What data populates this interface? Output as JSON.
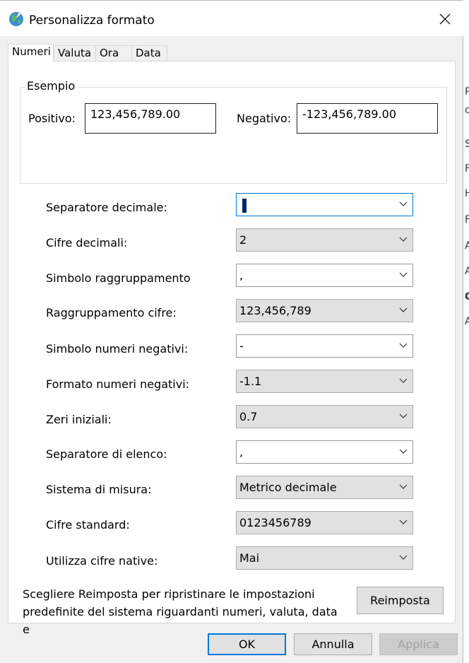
{
  "window": {
    "title": "Personalizza formato",
    "app_icon": "globe-icon",
    "close_icon": "close-icon"
  },
  "tabs": [
    {
      "label": "Numeri",
      "active": true
    },
    {
      "label": "Valuta",
      "active": false
    },
    {
      "label": "Ora",
      "active": false
    },
    {
      "label": "Data",
      "active": false
    }
  ],
  "example": {
    "legend": "Esempio",
    "positive_label": "Positivo:",
    "positive_value": "123,456,789.00",
    "negative_label": "Negativo:",
    "negative_value": "-123,456,789.00"
  },
  "settings": [
    {
      "label": "Separatore decimale:",
      "value": "",
      "kind": "edit",
      "focused": true
    },
    {
      "label": "Cifre decimali:",
      "value": "2",
      "kind": "list"
    },
    {
      "label": "Simbolo raggruppamento",
      "value": ",",
      "kind": "edit"
    },
    {
      "label": "Raggruppamento cifre:",
      "value": "123,456,789",
      "kind": "list"
    },
    {
      "label": "Simbolo numeri negativi:",
      "value": "-",
      "kind": "edit"
    },
    {
      "label": "Formato numeri negativi:",
      "value": "-1.1",
      "kind": "list"
    },
    {
      "label": "Zeri iniziali:",
      "value": "0.7",
      "kind": "list"
    },
    {
      "label": "Separatore di elenco:",
      "value": ",",
      "kind": "edit"
    },
    {
      "label": "Sistema di misura:",
      "value": "Metrico decimale",
      "kind": "list"
    },
    {
      "label": "Cifre standard:",
      "value": "0123456789",
      "kind": "list"
    },
    {
      "label": "Utilizza cifre native:",
      "value": "Mai",
      "kind": "list"
    }
  ],
  "reset": {
    "text_line1": "Scegliere Reimposta per ripristinare le impostazioni",
    "text_line2": "predefinite del sistema riguardanti numeri, valuta, data e",
    "button": "Reimposta"
  },
  "buttons": {
    "ok": "OK",
    "cancel": "Annulla",
    "apply": "Applica"
  },
  "background_window_fragments": [
    "P",
    "c",
    "S",
    "F",
    "H",
    "F",
    "A",
    "A",
    "C",
    "A"
  ],
  "colors": {
    "focus_blue": "#0078d7",
    "dialog_bg": "#f0f0f0",
    "panel_bg": "#ffffff",
    "combo_bg": "#e1e1e1"
  }
}
